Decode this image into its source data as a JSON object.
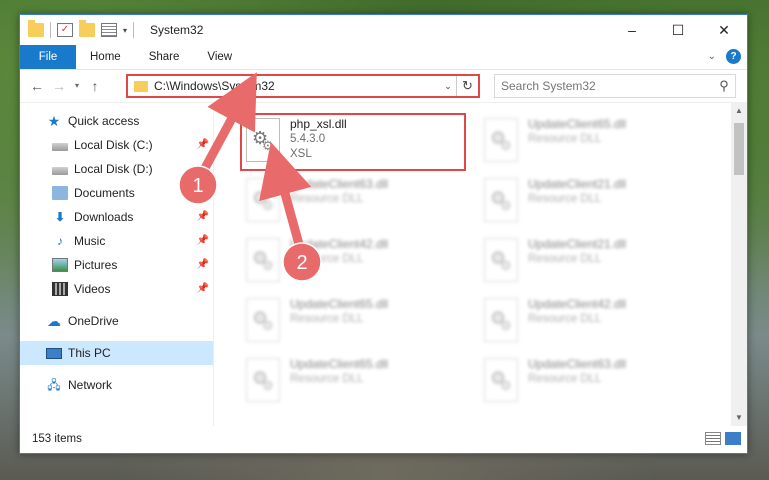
{
  "window": {
    "title": "System32",
    "controls": {
      "minimize": "–",
      "maximize": "☐",
      "close": "✕"
    }
  },
  "ribbon": {
    "tabs": [
      "File",
      "Home",
      "Share",
      "View"
    ]
  },
  "address_bar": {
    "path": "C:\\Windows\\System32",
    "search_placeholder": "Search System32"
  },
  "navigation": {
    "quick_access": "Quick access",
    "items": [
      {
        "label": "Local Disk (C:)",
        "icon": "drive-icon",
        "pinned": true
      },
      {
        "label": "Local Disk (D:)",
        "icon": "drive-icon",
        "pinned": false
      },
      {
        "label": "Documents",
        "icon": "documents-icon",
        "pinned": true
      },
      {
        "label": "Downloads",
        "icon": "downloads-icon",
        "pinned": true
      },
      {
        "label": "Music",
        "icon": "music-icon",
        "pinned": true
      },
      {
        "label": "Pictures",
        "icon": "pictures-icon",
        "pinned": true
      },
      {
        "label": "Videos",
        "icon": "videos-icon",
        "pinned": true
      }
    ],
    "onedrive": "OneDrive",
    "this_pc": "This PC",
    "network": "Network"
  },
  "files": [
    {
      "name": "php_xsl.dll",
      "line2": "5.4.3.0",
      "line3": "XSL",
      "highlighted": true
    },
    {
      "name": "UpdateClient65.dll",
      "line2": "Resource DLL",
      "line3": ""
    },
    {
      "name": "UpdateClient63.dll",
      "line2": "Resource DLL",
      "line3": ""
    },
    {
      "name": "UpdateClient21.dll",
      "line2": "Resource DLL",
      "line3": ""
    },
    {
      "name": "UpdateClient42.dll",
      "line2": "Resource DLL",
      "line3": ""
    },
    {
      "name": "UpdateClient21.dll",
      "line2": "Resource DLL",
      "line3": ""
    },
    {
      "name": "UpdateClient65.dll",
      "line2": "Resource DLL",
      "line3": ""
    },
    {
      "name": "UpdateClient42.dll",
      "line2": "Resource DLL",
      "line3": ""
    },
    {
      "name": "UpdateClient65.dll",
      "line2": "Resource DLL",
      "line3": ""
    },
    {
      "name": "UpdateClient63.dll",
      "line2": "Resource DLL",
      "line3": ""
    }
  ],
  "status": {
    "item_count": "153 items"
  },
  "annotations": {
    "step1": "1",
    "step2": "2",
    "color": "#e04848"
  },
  "colors": {
    "accent": "#1979ca",
    "highlight": "#e04848",
    "selected": "#cce8ff"
  }
}
